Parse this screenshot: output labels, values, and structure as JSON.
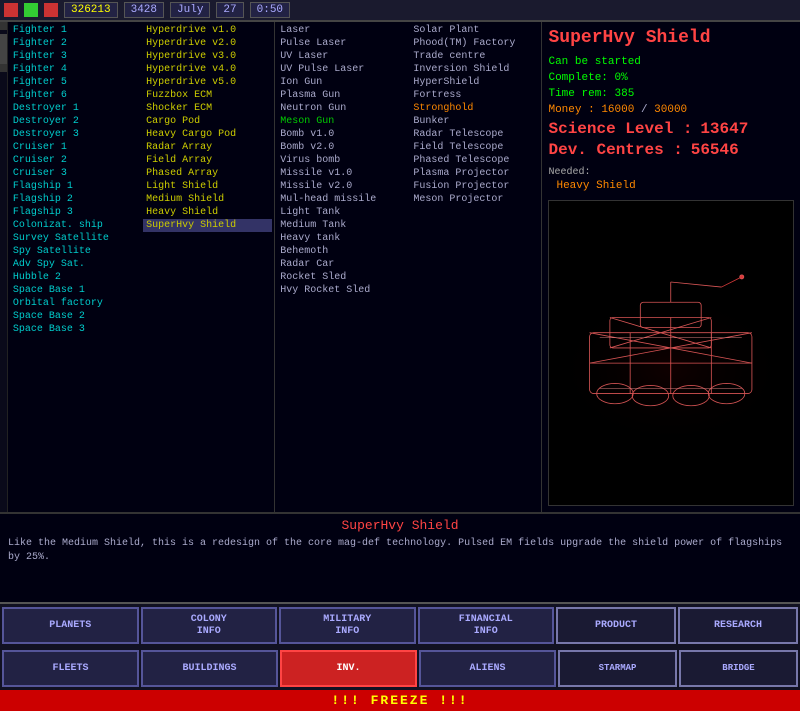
{
  "topbar": {
    "money": "326213",
    "production": "3428",
    "month": "July",
    "day": "27",
    "time": "0:50"
  },
  "leftPanel": {
    "col1": [
      {
        "label": "Fighter 1",
        "color": "cyan"
      },
      {
        "label": "Fighter 2",
        "color": "cyan"
      },
      {
        "label": "Fighter 3",
        "color": "cyan"
      },
      {
        "label": "Fighter 4",
        "color": "cyan"
      },
      {
        "label": "Fighter 5",
        "color": "cyan"
      },
      {
        "label": "Fighter 6",
        "color": "cyan"
      },
      {
        "label": "Destroyer 1",
        "color": "cyan"
      },
      {
        "label": "Destroyer 2",
        "color": "cyan"
      },
      {
        "label": "Destroyer 3",
        "color": "cyan"
      },
      {
        "label": "Cruiser 1",
        "color": "cyan"
      },
      {
        "label": "Cruiser 2",
        "color": "cyan"
      },
      {
        "label": "Cruiser 3",
        "color": "cyan"
      },
      {
        "label": "Flagship 1",
        "color": "cyan"
      },
      {
        "label": "Flagship 2",
        "color": "cyan"
      },
      {
        "label": "Flagship 3",
        "color": "cyan"
      },
      {
        "label": "Colonizat. ship",
        "color": "cyan"
      },
      {
        "label": "Survey Satellite",
        "color": "cyan"
      },
      {
        "label": "Spy Satellite",
        "color": "cyan"
      },
      {
        "label": "Adv Spy Sat.",
        "color": "cyan"
      },
      {
        "label": "Hubble 2",
        "color": "cyan"
      },
      {
        "label": "Space Base 1",
        "color": "cyan"
      },
      {
        "label": "Orbital factory",
        "color": "cyan"
      },
      {
        "label": "Space Base 2",
        "color": "cyan"
      },
      {
        "label": "Space Base 3",
        "color": "cyan"
      }
    ],
    "col2": [
      {
        "label": "Hyperdrive v1.0",
        "color": "yellow"
      },
      {
        "label": "Hyperdrive v2.0",
        "color": "yellow"
      },
      {
        "label": "Hyperdrive v3.0",
        "color": "yellow"
      },
      {
        "label": "Hyperdrive v4.0",
        "color": "yellow"
      },
      {
        "label": "Hyperdrive v5.0",
        "color": "yellow"
      },
      {
        "label": "Fuzzbox ECM",
        "color": "yellow"
      },
      {
        "label": "Shocker ECM",
        "color": "yellow"
      },
      {
        "label": "Cargo Pod",
        "color": "yellow"
      },
      {
        "label": "Heavy Cargo Pod",
        "color": "yellow"
      },
      {
        "label": "Radar Array",
        "color": "yellow"
      },
      {
        "label": "Field Array",
        "color": "yellow"
      },
      {
        "label": "Phased Array",
        "color": "yellow"
      },
      {
        "label": "Light Shield",
        "color": "yellow"
      },
      {
        "label": "Medium Shield",
        "color": "yellow"
      },
      {
        "label": "Heavy Shield",
        "color": "yellow"
      },
      {
        "label": "SuperHvy Shield",
        "color": "yellow",
        "selected": true
      }
    ]
  },
  "midPanel": {
    "col1": [
      {
        "label": "Laser",
        "color": "normal"
      },
      {
        "label": "Pulse Laser",
        "color": "normal"
      },
      {
        "label": "UV Laser",
        "color": "normal"
      },
      {
        "label": "UV Pulse Laser",
        "color": "normal"
      },
      {
        "label": "Ion Gun",
        "color": "normal"
      },
      {
        "label": "Plasma Gun",
        "color": "normal"
      },
      {
        "label": "Neutron Gun",
        "color": "normal"
      },
      {
        "label": "Meson Gun",
        "color": "green"
      },
      {
        "label": "Bomb v1.0",
        "color": "normal"
      },
      {
        "label": "Bomb v2.0",
        "color": "normal"
      },
      {
        "label": "Virus bomb",
        "color": "normal"
      },
      {
        "label": "Missile v1.0",
        "color": "normal"
      },
      {
        "label": "Missile v2.0",
        "color": "normal"
      },
      {
        "label": "Mul-head missile",
        "color": "normal"
      },
      {
        "label": "Light Tank",
        "color": "normal"
      },
      {
        "label": "Medium Tank",
        "color": "normal"
      },
      {
        "label": "Heavy tank",
        "color": "normal"
      },
      {
        "label": "Behemoth",
        "color": "normal"
      },
      {
        "label": "Radar Car",
        "color": "normal"
      },
      {
        "label": "Rocket Sled",
        "color": "normal"
      },
      {
        "label": "Hvy Rocket Sled",
        "color": "normal"
      }
    ],
    "col2": [
      {
        "label": "Solar Plant",
        "color": "normal"
      },
      {
        "label": "Phood(TM) Factory",
        "color": "normal"
      },
      {
        "label": "Trade centre",
        "color": "normal"
      },
      {
        "label": "Inversion Shield",
        "color": "normal"
      },
      {
        "label": "HyperShield",
        "color": "normal"
      },
      {
        "label": "Fortress",
        "color": "normal"
      },
      {
        "label": "Stronghold",
        "color": "orange"
      },
      {
        "label": "Bunker",
        "color": "normal"
      },
      {
        "label": "Radar Telescope",
        "color": "normal"
      },
      {
        "label": "Field Telescope",
        "color": "normal"
      },
      {
        "label": "Phased Telescope",
        "color": "normal"
      },
      {
        "label": "Plasma Projector",
        "color": "normal"
      },
      {
        "label": "Fusion Projector",
        "color": "normal"
      },
      {
        "label": "Meson Projector",
        "color": "normal"
      }
    ]
  },
  "rightPanel": {
    "title": "SuperHvy Shield",
    "status": "Can be started",
    "complete": "Complete: 0%",
    "timeRem": "Time rem: 385",
    "moneyLabel": "Money :",
    "moneyCurrent": "16000",
    "moneyTotal": "30000",
    "scienceLabel": "Science Level :",
    "scienceValue": "13647",
    "devLabel": "Dev. Centres :",
    "devValue": "56546",
    "neededLabel": "Needed:",
    "neededValue": "Heavy Shield"
  },
  "descArea": {
    "title": "SuperHvy Shield",
    "text": "Like the Medium Shield, this is a redesign of the core mag-def technology. Pulsed EM fields upgrade the shield power of flagships by 25%."
  },
  "bottomButtons": {
    "row1": [
      {
        "label": "PLANETS",
        "active": false
      },
      {
        "label": "COLONY\nINFO",
        "active": false
      },
      {
        "label": "MILITARY\nINFO",
        "active": false
      },
      {
        "label": "FINANCIAL\nINFO",
        "active": false
      },
      {
        "label": "PRODUCT",
        "active": false,
        "right": true
      },
      {
        "label": "RESEARCH",
        "active": false,
        "right": true
      }
    ],
    "row2": [
      {
        "label": "FLEETS",
        "active": false
      },
      {
        "label": "BUILDINGS",
        "active": false
      },
      {
        "label": "INV.",
        "active": true
      },
      {
        "label": "ALIENS",
        "active": false
      }
    ]
  },
  "freezeBar": "!!! FREEZE !!!"
}
